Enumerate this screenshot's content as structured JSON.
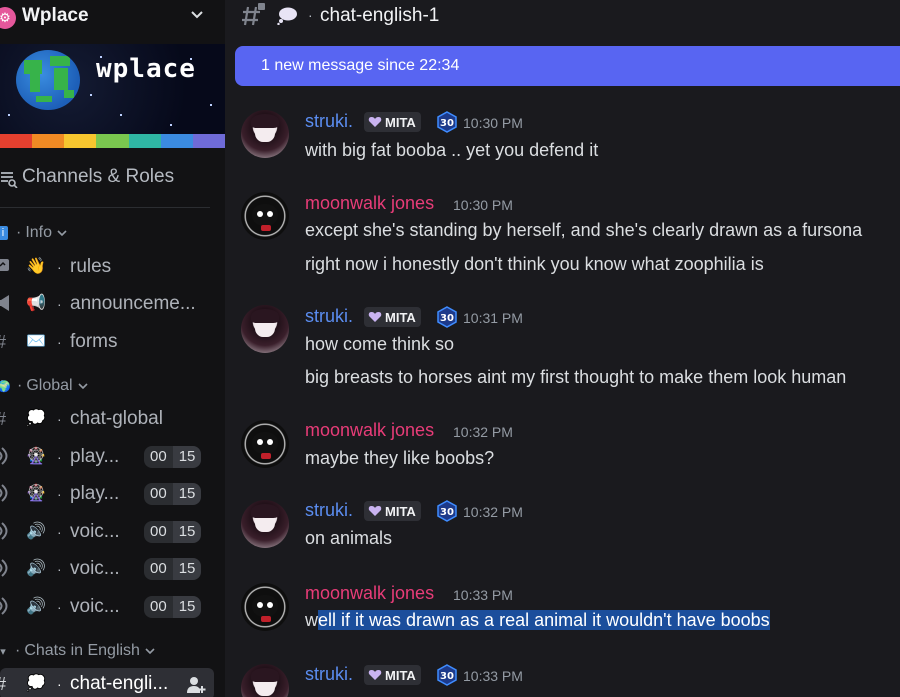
{
  "server": {
    "name": "Wplace",
    "banner_logo": "wplace"
  },
  "sidebar": {
    "channels_roles": "Channels & Roles",
    "categories": [
      {
        "label": "Info"
      },
      {
        "label": "Global"
      },
      {
        "label": "Chats in English"
      }
    ],
    "channels": [
      {
        "label": "rules",
        "emoji": "👋"
      },
      {
        "label": "announceme...",
        "emoji": "📢"
      },
      {
        "label": "forms",
        "emoji": "✉️"
      },
      {
        "label": "chat-global",
        "emoji": "💭"
      },
      {
        "label": "play...",
        "emoji": "🎡",
        "counter_a": "00",
        "counter_b": "15"
      },
      {
        "label": "play...",
        "emoji": "🎡",
        "counter_a": "00",
        "counter_b": "15"
      },
      {
        "label": "voic...",
        "emoji": "🔊",
        "counter_a": "00",
        "counter_b": "15"
      },
      {
        "label": "voic...",
        "emoji": "🔊",
        "counter_a": "00",
        "counter_b": "15"
      },
      {
        "label": "voic...",
        "emoji": "🔊",
        "counter_a": "00",
        "counter_b": "15"
      },
      {
        "label": "chat-engli...",
        "emoji": "💭"
      }
    ]
  },
  "topbar": {
    "channel_title": "chat-english-1"
  },
  "new_message_bar": {
    "text": "1 new message since 22:34"
  },
  "colors": {
    "accent": "#5865f2",
    "struki_name": "#5b8df0",
    "moonwalk_name": "#e83c78",
    "highlight": "#1b4e9c"
  },
  "messages": [
    {
      "author": "struki.",
      "tag": "MITA",
      "level": "30",
      "time": "10:30 PM",
      "lines": [
        "with big fat booba .. yet you defend it"
      ]
    },
    {
      "author": "moonwalk jones",
      "time": "10:30 PM",
      "lines": [
        "except she's standing by herself, and she's clearly drawn as a fursona",
        "right now i honestly don't think you know what zoophilia is"
      ]
    },
    {
      "author": "struki.",
      "tag": "MITA",
      "level": "30",
      "time": "10:31 PM",
      "lines": [
        "how come think so",
        "big breasts to horses aint my first thought to make them look human"
      ]
    },
    {
      "author": "moonwalk jones",
      "time": "10:32 PM",
      "lines": [
        "maybe they like boobs?"
      ]
    },
    {
      "author": "struki.",
      "tag": "MITA",
      "level": "30",
      "time": "10:32 PM",
      "lines": [
        "on animals"
      ]
    },
    {
      "author": "moonwalk jones",
      "time": "10:33 PM",
      "lines_pre": "w",
      "lines_highlight": "ell if it was drawn as a real animal it wouldn't have boobs"
    },
    {
      "author": "struki.",
      "tag": "MITA",
      "level": "30",
      "time": "10:33 PM"
    }
  ]
}
